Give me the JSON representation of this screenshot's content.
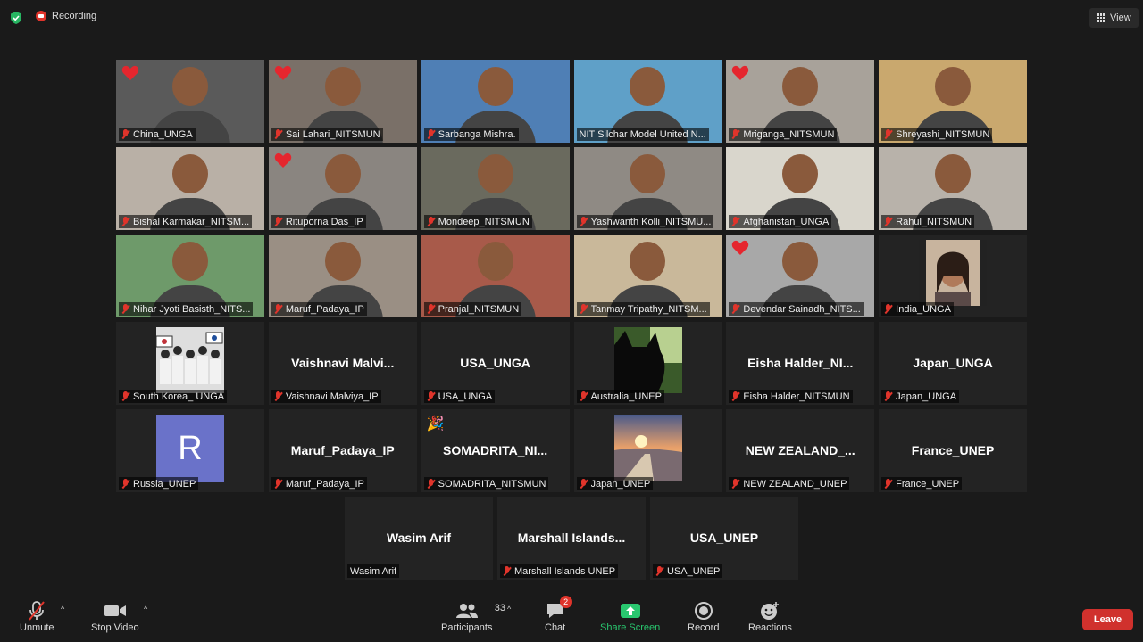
{
  "topbar": {
    "recording_label": "Recording",
    "view_label": "View"
  },
  "gallery": {
    "rows": [
      [
        {
          "name": "China_UNGA",
          "video": true,
          "heart": true,
          "scene": "#5a5a5a"
        },
        {
          "name": "Sai Lahari_NITSMUN",
          "video": true,
          "heart": true,
          "scene": "#7a7068"
        },
        {
          "name": "Sarbanga Mishra.",
          "video": true,
          "heart": false,
          "scene": "#4f7fb5"
        },
        {
          "name": "NIT Silchar Model United N...",
          "video": true,
          "heart": false,
          "active": true,
          "mic_on": true,
          "scene": "#5fa0c8"
        },
        {
          "name": "Mriganga_NITSMUN",
          "video": true,
          "heart": true,
          "scene": "#a8a29a"
        },
        {
          "name": "Shreyashi_NITSMUN",
          "video": true,
          "heart": false,
          "scene": "#c9a86e"
        }
      ],
      [
        {
          "name": "Bishal Karmakar_NITSM...",
          "video": true,
          "heart": false,
          "scene": "#b9b0a6"
        },
        {
          "name": "Rituporna Das_IP",
          "video": true,
          "heart": true,
          "scene": "#8a8580"
        },
        {
          "name": "Mondeep_NITSMUN",
          "video": true,
          "heart": false,
          "scene": "#6a6a5e"
        },
        {
          "name": "Yashwanth Kolli_NITSMU...",
          "video": true,
          "heart": false,
          "scene": "#8f8a84"
        },
        {
          "name": "Afghanistan_UNGA",
          "video": true,
          "heart": false,
          "scene": "#d9d6cc"
        },
        {
          "name": "Rahul_NITSMUN",
          "video": true,
          "heart": false,
          "scene": "#b8b2aa"
        }
      ],
      [
        {
          "name": "Nihar Jyoti Basisth_NITS...",
          "video": true,
          "heart": false,
          "scene": "#6e9a6a"
        },
        {
          "name": "Maruf_Padaya_IP",
          "video": true,
          "heart": false,
          "scene": "#9a8f84"
        },
        {
          "name": "Pranjal_NITSMUN",
          "video": true,
          "heart": false,
          "scene": "#a85a4a"
        },
        {
          "name": "Tanmay Tripathy_NITSM...",
          "video": true,
          "heart": false,
          "scene": "#c9b89a"
        },
        {
          "name": "Devendar Sainadh_NITS...",
          "video": true,
          "heart": true,
          "scene": "#a8a8a8"
        },
        {
          "name": "India_UNGA",
          "video": false,
          "thumb": "portrait",
          "heart": false
        }
      ],
      [
        {
          "name": "South Korea_ UNGA",
          "video": false,
          "thumb": "crowd",
          "heart": false
        },
        {
          "name": "Vaishnavi Malviya_IP",
          "video": false,
          "big": "Vaishnavi  Malvi...",
          "heart": false
        },
        {
          "name": "USA_UNGA",
          "video": false,
          "big": "USA_UNGA",
          "heart": false
        },
        {
          "name": "Australia_UNEP",
          "video": false,
          "thumb": "cat",
          "heart": false
        },
        {
          "name": "Eisha Halder_NITSMUN",
          "video": false,
          "big": "Eisha  Halder_NI...",
          "heart": false
        },
        {
          "name": "Japan_UNGA",
          "video": false,
          "big": "Japan_UNGA",
          "heart": false
        }
      ],
      [
        {
          "name": "Russia_UNEP",
          "video": false,
          "avatar": "R",
          "heart": false
        },
        {
          "name": "Maruf_Padaya_IP",
          "video": false,
          "big": "Maruf_Padaya_IP",
          "heart": false
        },
        {
          "name": "SOMADRITA_NITSMUN",
          "video": false,
          "big": "SOMADRITA_NI...",
          "party": true,
          "heart": false
        },
        {
          "name": "Japan_UNEP",
          "video": false,
          "thumb": "sunset",
          "heart": false
        },
        {
          "name": "NEW ZEALAND_UNEP",
          "video": false,
          "big": "NEW  ZEALAND_...",
          "heart": false
        },
        {
          "name": "France_UNEP",
          "video": false,
          "big": "France_UNEP",
          "heart": false
        }
      ],
      [
        {
          "name": "Wasim Arif",
          "video": false,
          "big": "Wasim Arif",
          "heart": false,
          "mic_on": true
        },
        {
          "name": "Marshall Islands UNEP",
          "video": false,
          "big": "Marshall  Islands...",
          "heart": false
        },
        {
          "name": "USA_UNEP",
          "video": false,
          "big": "USA_UNEP",
          "heart": false
        }
      ]
    ]
  },
  "toolbar": {
    "unmute": "Unmute",
    "stop_video": "Stop Video",
    "participants": "Participants",
    "participants_count": "33",
    "chat": "Chat",
    "chat_badge": "2",
    "share_screen": "Share Screen",
    "record": "Record",
    "reactions": "Reactions",
    "leave": "Leave",
    "colors": {
      "share": "#29c76f",
      "leave": "#d0312d",
      "active_border": "#d8e04a"
    }
  }
}
